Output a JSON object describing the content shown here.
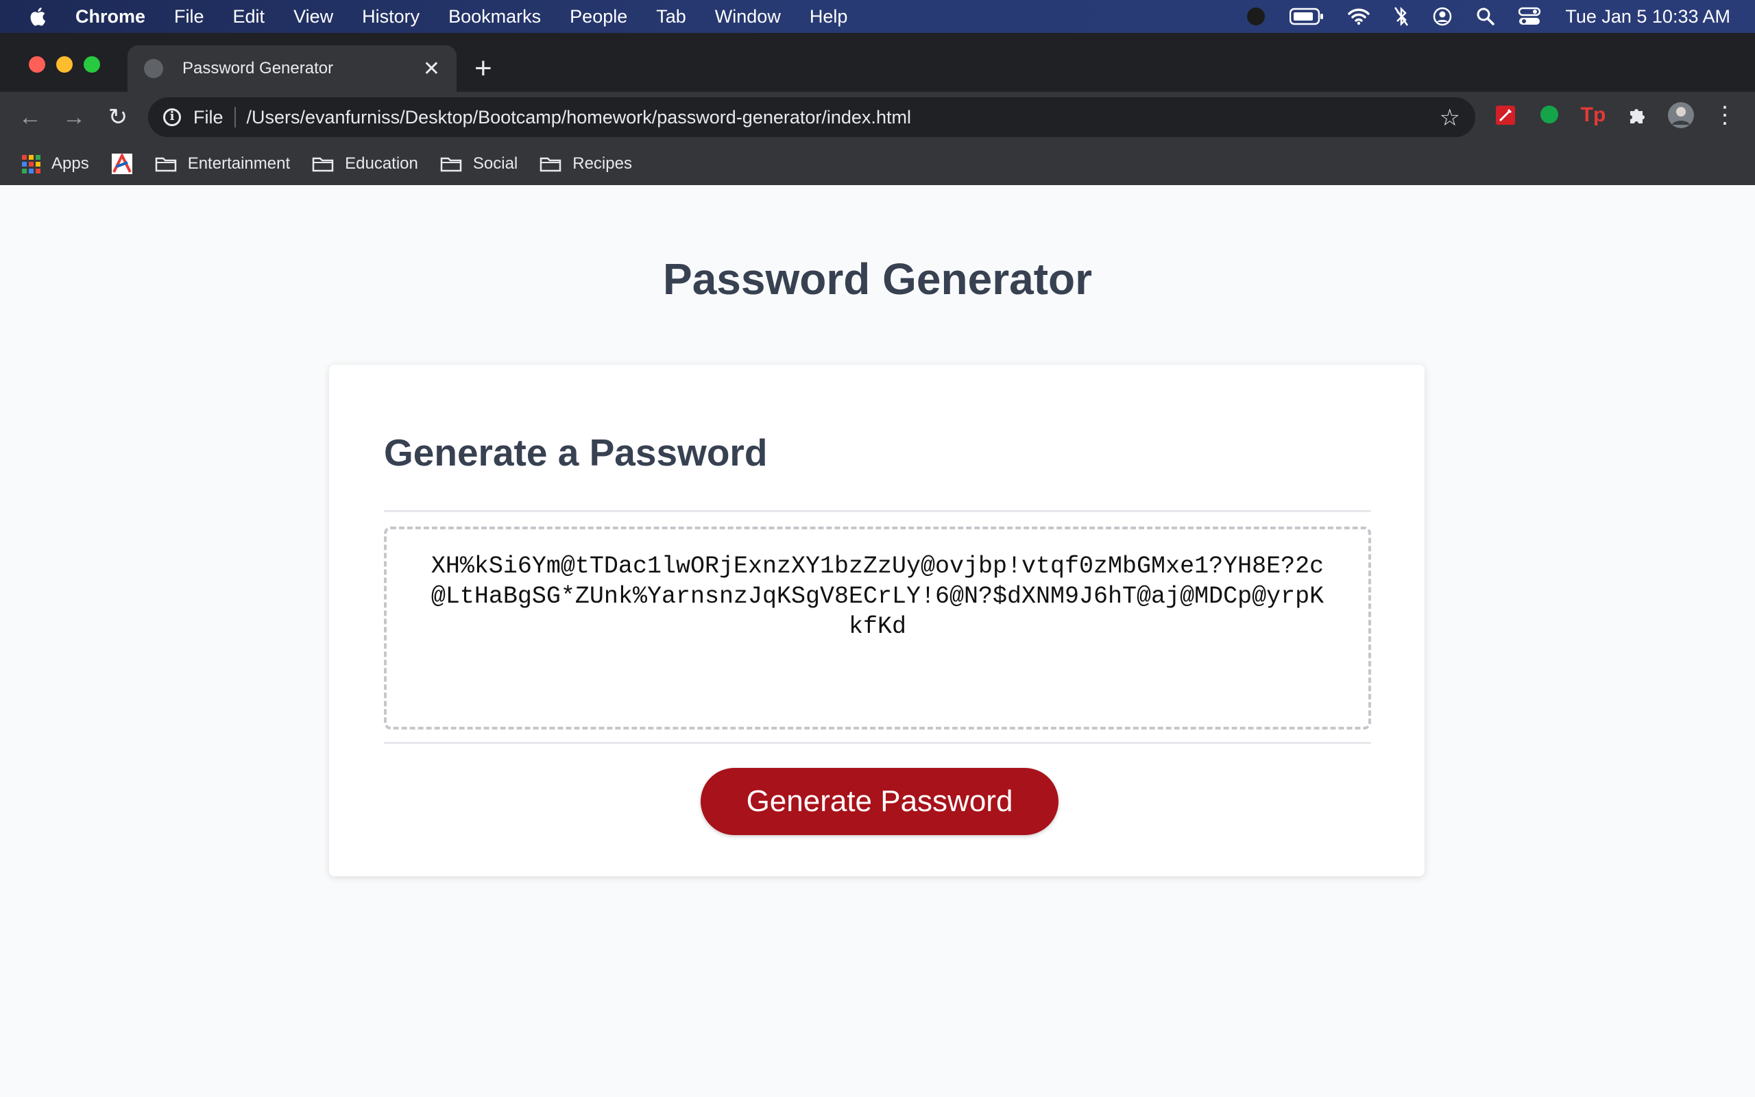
{
  "menubar": {
    "app_name": "Chrome",
    "items": [
      "File",
      "Edit",
      "View",
      "History",
      "Bookmarks",
      "People",
      "Tab",
      "Window",
      "Help"
    ],
    "clock": "Tue Jan 5  10:33 AM"
  },
  "browser": {
    "tab_title": "Password Generator",
    "scheme_label": "File",
    "url": "/Users/evanfurniss/Desktop/Bootcamp/homework/password-generator/index.html",
    "bookmarks": [
      "Apps",
      "Entertainment",
      "Education",
      "Social",
      "Recipes"
    ]
  },
  "page": {
    "title": "Password Generator",
    "card_header": "Generate a Password",
    "password_value": "XH%kSi6Ym@tTDac1lwORjExnzXY1bzZzUy@ovjbp!vtqf0zMbGMxe1?YH8E?2c@LtHaBgSG*ZUnk%YarnsnzJqKSgV8ECrLY!6@N?$dXNM9J6hT@aj@MDCp@yrpKkfKd",
    "button_label": "Generate Password",
    "accent_color": "#a8121a"
  }
}
